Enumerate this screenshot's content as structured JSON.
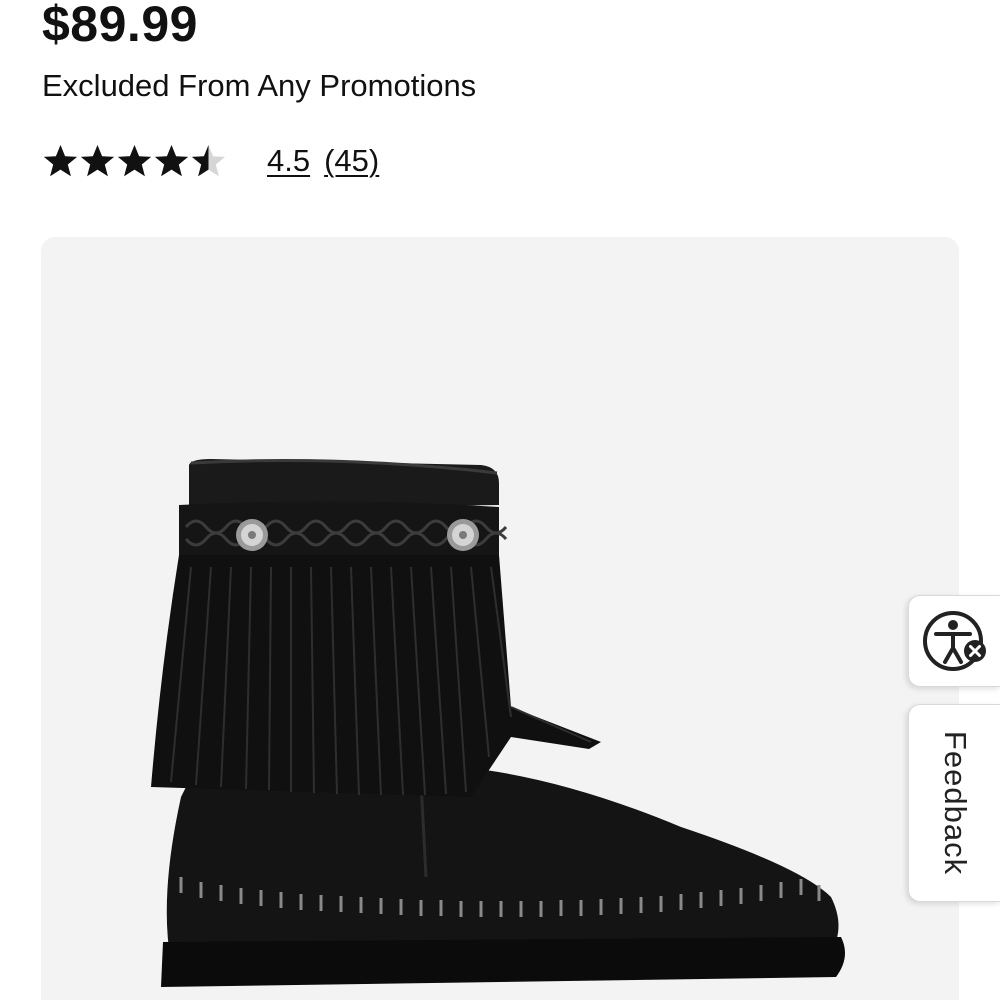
{
  "product": {
    "price": "$89.99",
    "promo_note": "Excluded From Any Promotions",
    "rating": {
      "value": 4.5,
      "max": 5,
      "display": "4.5",
      "count_display": "(45)"
    },
    "image": {
      "subject": "black suede fringe ankle boot with braided band and silver conchos",
      "background_color": "#f3f3f3"
    }
  },
  "side_tabs": {
    "accessibility_icon": "accessibility-person-icon",
    "feedback_label": "Feedback"
  },
  "colors": {
    "text": "#111111",
    "star_fill": "#111111",
    "star_empty": "#d6d6d6"
  }
}
